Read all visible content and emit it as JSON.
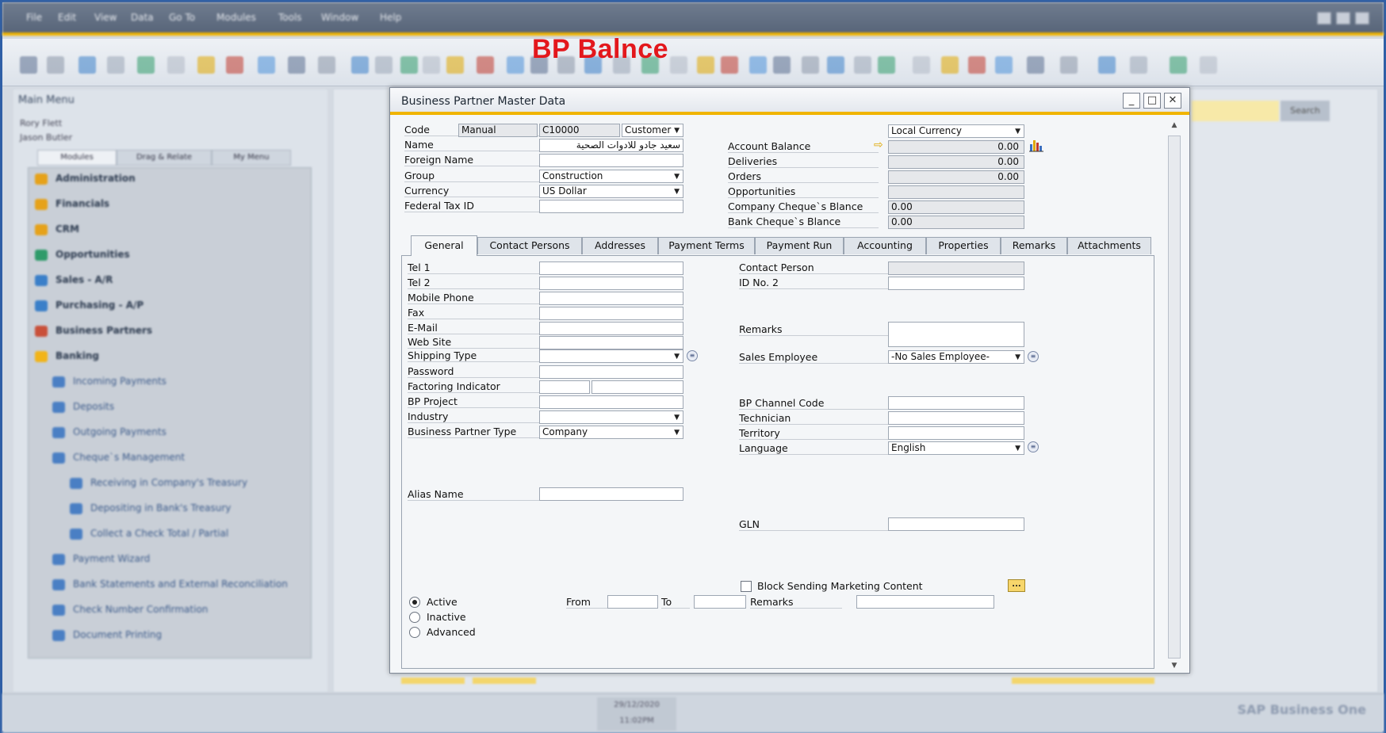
{
  "overlay_title": "BP Balnce",
  "menubar": {
    "items": [
      "File",
      "Edit",
      "View",
      "Data",
      "Go To",
      "Modules",
      "Tools",
      "Window",
      "Help"
    ]
  },
  "main_menu": {
    "title": "Main Menu",
    "users": [
      "Rory Flett",
      "Jason Butler"
    ],
    "tabs": [
      "Modules",
      "Drag & Relate",
      "My Menu"
    ],
    "items": [
      {
        "label": "Administration",
        "icon": "admin-icon",
        "color": "#e6a21a"
      },
      {
        "label": "Financials",
        "icon": "financials-icon",
        "color": "#e6a21a"
      },
      {
        "label": "CRM",
        "icon": "crm-icon",
        "color": "#e6a21a"
      },
      {
        "label": "Opportunities",
        "icon": "opportunities-icon",
        "color": "#2f9b6a"
      },
      {
        "label": "Sales - A/R",
        "icon": "sales-icon",
        "color": "#3a7fc9"
      },
      {
        "label": "Purchasing - A/P",
        "icon": "purchasing-icon",
        "color": "#3a7fc9"
      },
      {
        "label": "Business Partners",
        "icon": "partners-icon",
        "color": "#c9503a"
      },
      {
        "label": "Banking",
        "icon": "banking-icon",
        "color": "#f2b418"
      }
    ],
    "sub_items": [
      "Incoming Payments",
      "Deposits",
      "Outgoing Payments",
      "Cheque`s Management",
      "Receiving in Company's Treasury",
      "Depositing in Bank's Treasury",
      "Collect a Check Total / Partial",
      "Payment Wizard",
      "Bank Statements and External Reconciliation",
      "Check Number Confirmation",
      "Document Printing"
    ]
  },
  "search": {
    "button": "Search"
  },
  "statusbar": {
    "date": "29/12/2020",
    "time": "11:02PM",
    "logo": "SAP Business One"
  },
  "dialog": {
    "title": "Business Partner Master Data",
    "header": {
      "code_label": "Code",
      "code_series": "Manual",
      "code_value": "C10000",
      "type_value": "Customer",
      "name_label": "Name",
      "name_value": "سعيد جادو للادوات الصحية",
      "foreign_name_label": "Foreign Name",
      "foreign_name_value": "",
      "group_label": "Group",
      "group_value": "Construction",
      "currency_label": "Currency",
      "currency_value": "US Dollar",
      "tax_label": "Federal Tax ID",
      "tax_value": "",
      "balance_currency": "Local Currency",
      "account_balance_label": "Account Balance",
      "account_balance_value": "0.00",
      "deliveries_label": "Deliveries",
      "deliveries_value": "0.00",
      "orders_label": "Orders",
      "orders_value": "0.00",
      "opportunities_label": "Opportunities",
      "opportunities_value": "",
      "company_cheque_label": "Company Cheque`s Blance",
      "company_cheque_value": "0.00",
      "bank_cheque_label": "Bank Cheque`s Blance",
      "bank_cheque_value": "0.00"
    },
    "tabs": [
      "General",
      "Contact Persons",
      "Addresses",
      "Payment Terms",
      "Payment Run",
      "Accounting",
      "Properties",
      "Remarks",
      "Attachments"
    ],
    "general": {
      "tel1": "Tel 1",
      "tel2": "Tel 2",
      "mobile": "Mobile Phone",
      "fax": "Fax",
      "email": "E-Mail",
      "website": "Web Site",
      "shipping_type": "Shipping Type",
      "password": "Password",
      "factoring": "Factoring Indicator",
      "bp_project": "BP Project",
      "industry": "Industry",
      "bp_type": "Business Partner Type",
      "bp_type_value": "Company",
      "alias_name": "Alias Name",
      "contact_person": "Contact Person",
      "id_no2": "ID No. 2",
      "remarks": "Remarks",
      "sales_employee": "Sales Employee",
      "sales_employee_value": "-No Sales Employee-",
      "bp_channel_code": "BP Channel Code",
      "technician": "Technician",
      "territory": "Territory",
      "language": "Language",
      "language_value": "English",
      "gln": "GLN",
      "block_marketing": "Block Sending Marketing Content",
      "ellipsis": "...",
      "active": "Active",
      "inactive": "Inactive",
      "advanced": "Advanced",
      "from": "From",
      "to": "To",
      "status_remarks": "Remarks"
    }
  },
  "colors": {
    "accent": "#f0b400",
    "frame": "#2f5fa6",
    "title_red": "#e3171c"
  }
}
